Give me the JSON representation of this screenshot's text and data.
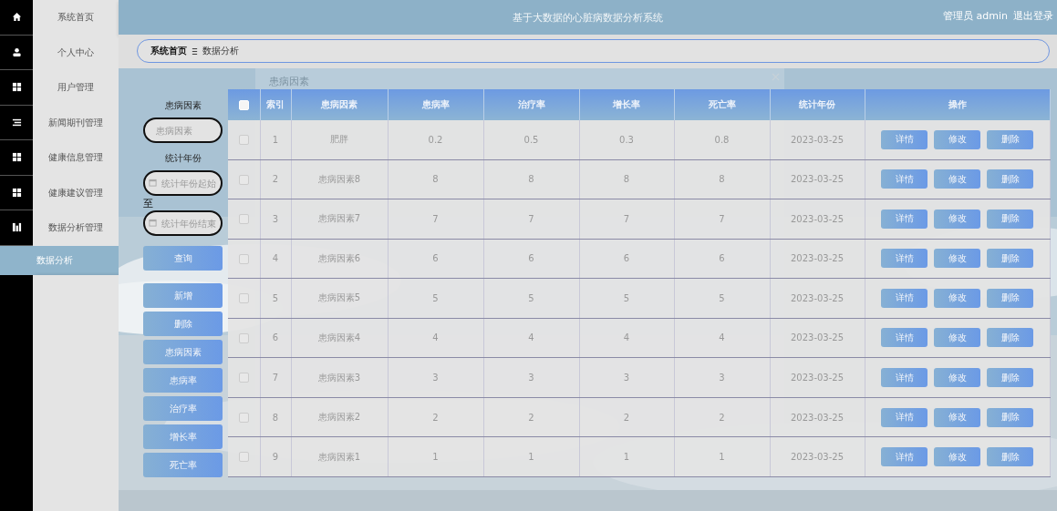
{
  "sidebar": {
    "items": [
      {
        "label": "系统首页",
        "selected": false
      },
      {
        "label": "个人中心",
        "selected": false
      },
      {
        "label": "用户管理",
        "selected": false
      },
      {
        "label": "新闻期刊管理",
        "selected": false
      },
      {
        "label": "健康信息管理",
        "selected": false
      },
      {
        "label": "健康建议管理",
        "selected": false
      },
      {
        "label": "数据分析管理",
        "selected": false,
        "children": [
          {
            "label": "数据分析",
            "selected": true
          }
        ]
      }
    ]
  },
  "header": {
    "title": "基于大数据的心脏病数据分析系统",
    "user": "管理员 admin",
    "logout": "退出登录"
  },
  "breadcrumb": [
    "系统首页",
    "数据分析"
  ],
  "dialog": {
    "title": "患病因素"
  },
  "filters": {
    "factor_label": "患病因素",
    "factor_placeholder": "患病因素",
    "year_label": "统计年份",
    "start_placeholder": "统计年份起始",
    "to": "至",
    "end_placeholder": "统计年份结束",
    "query": "查询"
  },
  "actions": [
    "新增",
    "删除",
    "患病因素",
    "患病率",
    "治疗率",
    "增长率",
    "死亡率"
  ],
  "table": {
    "columns": [
      "索引",
      "患病因素",
      "患病率",
      "治疗率",
      "增长率",
      "死亡率",
      "统计年份",
      "操作"
    ],
    "all_checked": false,
    "rows": [
      {
        "checked": false,
        "cells": [
          "1",
          "肥胖",
          "0.2",
          "0.5",
          "0.3",
          "0.8",
          "2023-03-25"
        ],
        "buttons": [
          "详情",
          "修改",
          "删除"
        ]
      },
      {
        "checked": false,
        "cells": [
          "2",
          "患病因素8",
          "8",
          "8",
          "8",
          "8",
          "2023-03-25"
        ],
        "buttons": [
          "详情",
          "修改",
          "删除"
        ]
      },
      {
        "checked": false,
        "cells": [
          "3",
          "患病因素7",
          "7",
          "7",
          "7",
          "7",
          "2023-03-25"
        ],
        "buttons": [
          "详情",
          "修改",
          "删除"
        ]
      },
      {
        "checked": false,
        "cells": [
          "4",
          "患病因素6",
          "6",
          "6",
          "6",
          "6",
          "2023-03-25"
        ],
        "buttons": [
          "详情",
          "修改",
          "删除"
        ]
      },
      {
        "checked": false,
        "cells": [
          "5",
          "患病因素5",
          "5",
          "5",
          "5",
          "5",
          "2023-03-25"
        ],
        "buttons": [
          "详情",
          "修改",
          "删除"
        ]
      },
      {
        "checked": false,
        "cells": [
          "6",
          "患病因素4",
          "4",
          "4",
          "4",
          "4",
          "2023-03-25"
        ],
        "buttons": [
          "详情",
          "修改",
          "删除"
        ]
      },
      {
        "checked": false,
        "cells": [
          "7",
          "患病因素3",
          "3",
          "3",
          "3",
          "3",
          "2023-03-25"
        ],
        "buttons": [
          "详情",
          "修改",
          "删除"
        ]
      },
      {
        "checked": false,
        "cells": [
          "8",
          "患病因素2",
          "2",
          "2",
          "2",
          "2",
          "2023-03-25"
        ],
        "buttons": [
          "详情",
          "修改",
          "删除"
        ]
      },
      {
        "checked": false,
        "cells": [
          "9",
          "患病因素1",
          "1",
          "1",
          "1",
          "1",
          "2023-03-25"
        ],
        "buttons": [
          "详情",
          "修改",
          "删除"
        ]
      }
    ]
  }
}
